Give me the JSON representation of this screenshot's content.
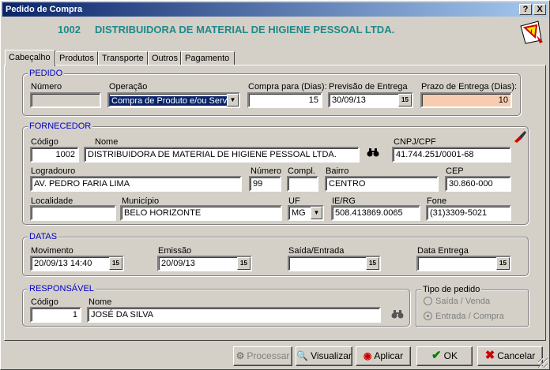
{
  "window": {
    "title": "Pedido de Compra",
    "help_btn": "?",
    "close_btn": "X"
  },
  "header": {
    "number": "1002",
    "name": "DISTRIBUIDORA DE MATERIAL DE HIGIENE PESSOAL LTDA."
  },
  "tabs": [
    "Cabeçalho",
    "Produtos",
    "Transporte",
    "Outros",
    "Pagamento"
  ],
  "pedido": {
    "title": "PEDIDO",
    "numero_label": "Número",
    "numero_value": "",
    "operacao_label": "Operação",
    "operacao_value": "Compra de Produto e/ou Servi",
    "compra_label": "Compra para (Dias):",
    "compra_value": "15",
    "previsao_label": "Previsão de Entrega",
    "previsao_value": "30/09/13",
    "prazo_label": "Prazo de Entrega (Dias):",
    "prazo_value": "10"
  },
  "fornecedor": {
    "title": "FORNECEDOR",
    "codigo_label": "Código",
    "codigo_value": "1002",
    "nome_label": "Nome",
    "nome_value": "DISTRIBUIDORA DE MATERIAL DE HIGIENE PESSOAL LTDA.",
    "cnpj_label": "CNPJ/CPF",
    "cnpj_value": "41.744.251/0001-68",
    "logradouro_label": "Logradouro",
    "logradouro_value": "AV. PEDRO FARIA LIMA",
    "numero_label": "Número",
    "numero_value": "99",
    "compl_label": "Compl.",
    "compl_value": "",
    "bairro_label": "Bairro",
    "bairro_value": "CENTRO",
    "cep_label": "CEP",
    "cep_value": "30.860-000",
    "localidade_label": "Localidade",
    "localidade_value": "",
    "municipio_label": "Município",
    "municipio_value": "BELO HORIZONTE",
    "uf_label": "UF",
    "uf_value": "MG",
    "ie_label": "IE/RG",
    "ie_value": "508.413869.0065",
    "fone_label": "Fone",
    "fone_value": "(31)3309-5021"
  },
  "datas": {
    "title": "DATAS",
    "movimento_label": "Movimento",
    "movimento_value": "20/09/13 14:40",
    "emissao_label": "Emissão",
    "emissao_value": "20/09/13",
    "saida_label": "Saída/Entrada",
    "saida_value": "",
    "entrega_label": "Data Entrega",
    "entrega_value": ""
  },
  "responsavel": {
    "title": "RESPONSÁVEL",
    "codigo_label": "Código",
    "codigo_value": "1",
    "nome_label": "Nome",
    "nome_value": "JOSÉ DA SILVA"
  },
  "tipo": {
    "title": "Tipo de pedido",
    "opt1": "Saída / Venda",
    "opt2": "Entrada / Compra"
  },
  "cal_glyph": "15",
  "buttons": {
    "processar": "Processar",
    "visualizar": "Visualizar",
    "aplicar": "Aplicar",
    "ok": "OK",
    "cancelar": "Cancelar"
  }
}
